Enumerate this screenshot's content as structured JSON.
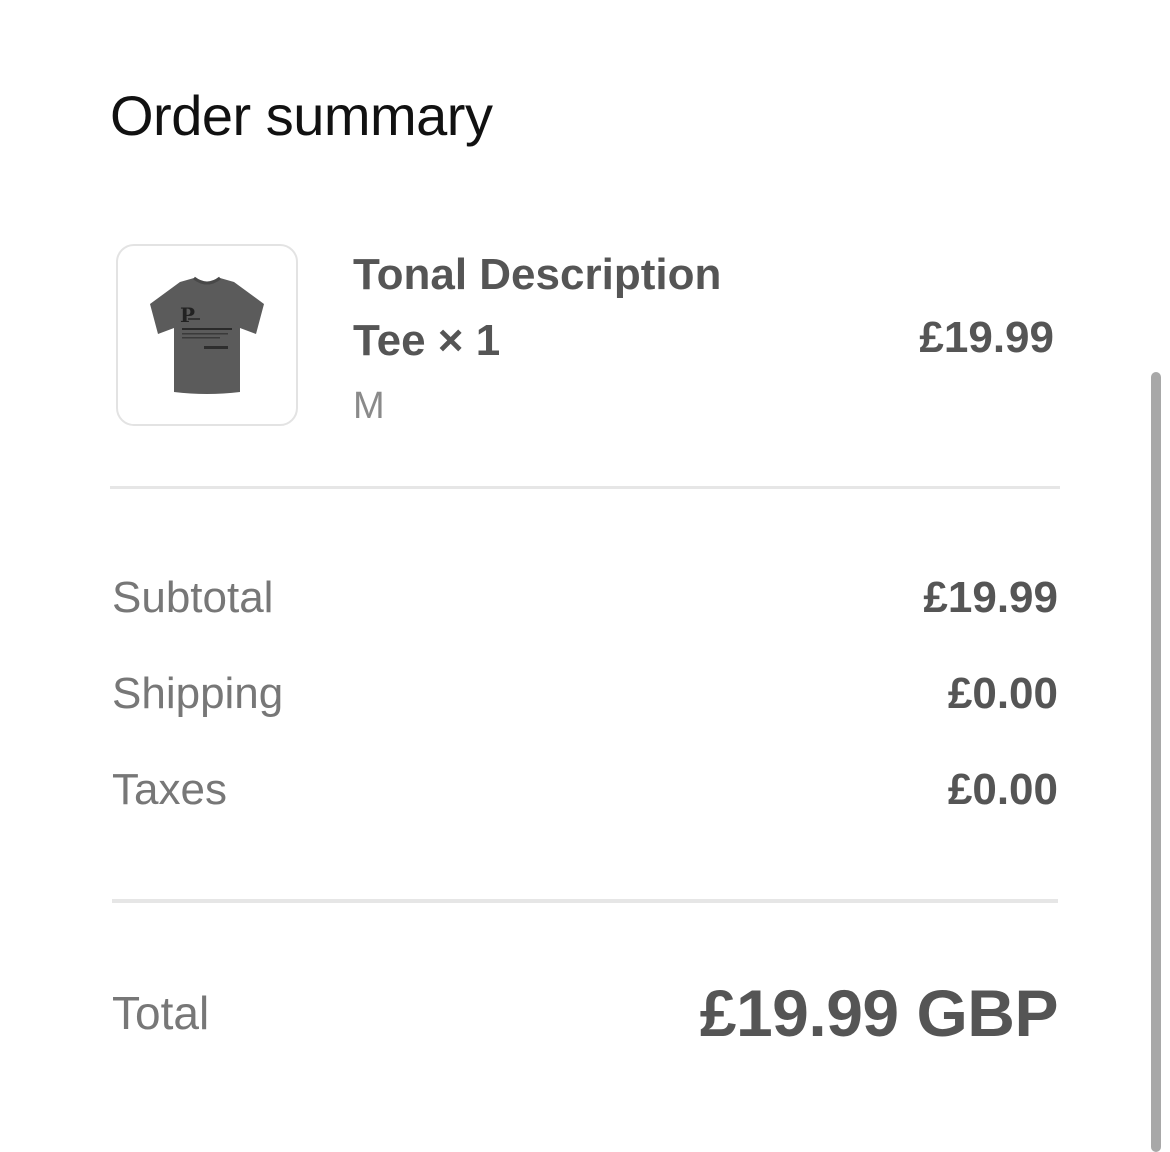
{
  "header": {
    "title": "Order summary"
  },
  "item": {
    "name": "Tonal Description Tee × 1",
    "variant": "M",
    "price": "£19.99",
    "thumbnail_icon": "tshirt-icon",
    "thumbnail_color": "#5b5b5b"
  },
  "summary": {
    "rows": [
      {
        "label": "Subtotal",
        "value": "£19.99"
      },
      {
        "label": "Shipping",
        "value": "£0.00"
      },
      {
        "label": "Taxes",
        "value": "£0.00"
      }
    ],
    "total": {
      "label": "Total",
      "value": "£19.99 GBP"
    }
  },
  "colors": {
    "text_dark": "#111111",
    "text_value": "#555555",
    "text_label": "#777777",
    "divider": "#e6e6e6"
  }
}
